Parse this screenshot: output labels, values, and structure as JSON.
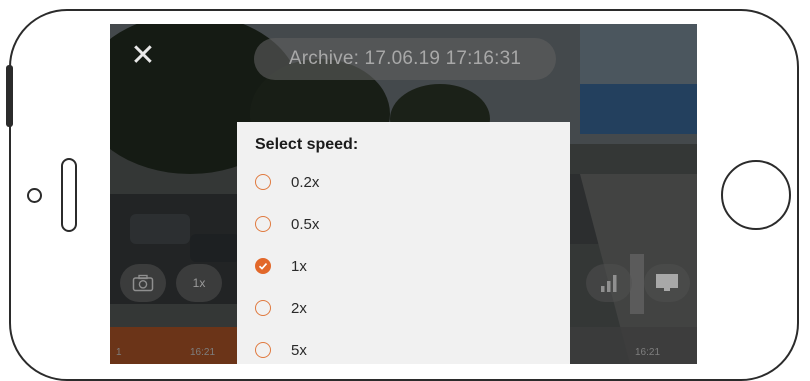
{
  "screen": {
    "archive_label": "Archive: 17.06.19 17:16:31",
    "close_glyph": "✕",
    "speed_button_label": "1x",
    "timeline": {
      "left_mark": "1",
      "left_time": "16:21",
      "right_time": "16:21",
      "progress_fraction": 0.22
    }
  },
  "speed_dialog": {
    "title": "Select speed:",
    "options": [
      {
        "label": "0.2x",
        "selected": false
      },
      {
        "label": "0.5x",
        "selected": false
      },
      {
        "label": "1x",
        "selected": true
      },
      {
        "label": "2x",
        "selected": false
      },
      {
        "label": "5x",
        "selected": false
      }
    ]
  },
  "colors": {
    "accent": "#e2682a",
    "dialog_bg": "#f1f1f1",
    "overlay": "#2e2f2f"
  },
  "icons": [
    "close-icon",
    "camera-icon",
    "signal-bars-icon",
    "monitor-icon",
    "checkmark-icon"
  ]
}
